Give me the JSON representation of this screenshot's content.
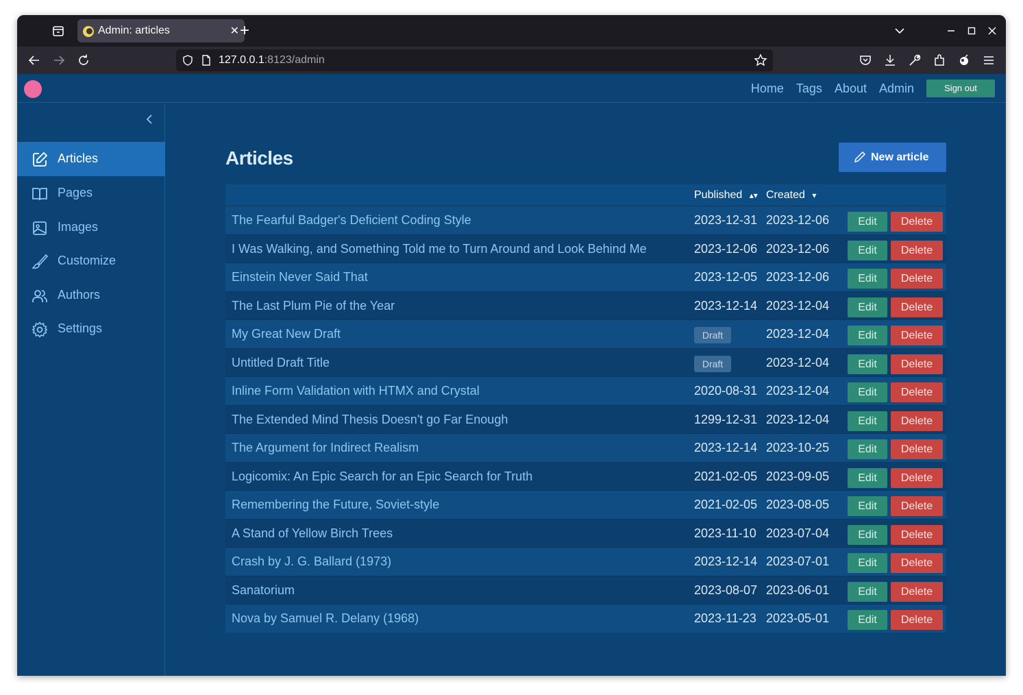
{
  "browser": {
    "tab_title": "Admin: articles",
    "url_host": "127.0.0.1",
    "url_rest": ":8123/admin"
  },
  "topnav": {
    "links": [
      "Home",
      "Tags",
      "About",
      "Admin"
    ],
    "signout": "Sign out"
  },
  "sidebar": {
    "items": [
      {
        "label": "Articles",
        "icon": "edit-icon",
        "active": true
      },
      {
        "label": "Pages",
        "icon": "book-icon"
      },
      {
        "label": "Images",
        "icon": "image-icon"
      },
      {
        "label": "Customize",
        "icon": "brush-icon"
      },
      {
        "label": "Authors",
        "icon": "users-icon"
      },
      {
        "label": "Settings",
        "icon": "gear-icon"
      }
    ]
  },
  "main": {
    "title": "Articles",
    "new_button": "New article",
    "columns": {
      "published": "Published",
      "published_sort": "▴▾",
      "created": "Created",
      "created_sort": "▾"
    },
    "draft_label": "Draft",
    "edit_label": "Edit",
    "delete_label": "Delete",
    "rows": [
      {
        "title": "The Fearful Badger's Deficient Coding Style",
        "published": "2023-12-31",
        "created": "2023-12-06"
      },
      {
        "title": "I Was Walking, and Something Told me to Turn Around and Look Behind Me",
        "published": "2023-12-06",
        "created": "2023-12-06"
      },
      {
        "title": "Einstein Never Said That",
        "published": "2023-12-05",
        "created": "2023-12-06"
      },
      {
        "title": "The Last Plum Pie of the Year",
        "published": "2023-12-14",
        "created": "2023-12-04"
      },
      {
        "title": "My Great New Draft",
        "published": null,
        "created": "2023-12-04"
      },
      {
        "title": "Untitled Draft Title",
        "published": null,
        "created": "2023-12-04"
      },
      {
        "title": "Inline Form Validation with HTMX and Crystal",
        "published": "2020-08-31",
        "created": "2023-12-04"
      },
      {
        "title": "The Extended Mind Thesis Doesn't go Far Enough",
        "published": "1299-12-31",
        "created": "2023-12-04"
      },
      {
        "title": "The Argument for Indirect Realism",
        "published": "2023-12-14",
        "created": "2023-10-25"
      },
      {
        "title": "Logicomix: An Epic Search for an Epic Search for Truth",
        "published": "2021-02-05",
        "created": "2023-09-05"
      },
      {
        "title": "Remembering the Future, Soviet-style",
        "published": "2021-02-05",
        "created": "2023-08-05"
      },
      {
        "title": "A Stand of Yellow Birch Trees",
        "published": "2023-11-10",
        "created": "2023-07-04"
      },
      {
        "title": "Crash by J. G. Ballard (1973)",
        "published": "2023-12-14",
        "created": "2023-07-01"
      },
      {
        "title": "Sanatorium",
        "published": "2023-08-07",
        "created": "2023-06-01"
      },
      {
        "title": "Nova by Samuel R. Delany (1968)",
        "published": "2023-11-23",
        "created": "2023-05-01"
      }
    ]
  },
  "colors": {
    "page_bg": "#0b4474",
    "link": "#8fc6ef",
    "active_sidebar": "#1f6fb8",
    "edit": "#2e8b76",
    "delete": "#c84542",
    "primary": "#2a6fc4",
    "logo": "#f06ba0"
  }
}
